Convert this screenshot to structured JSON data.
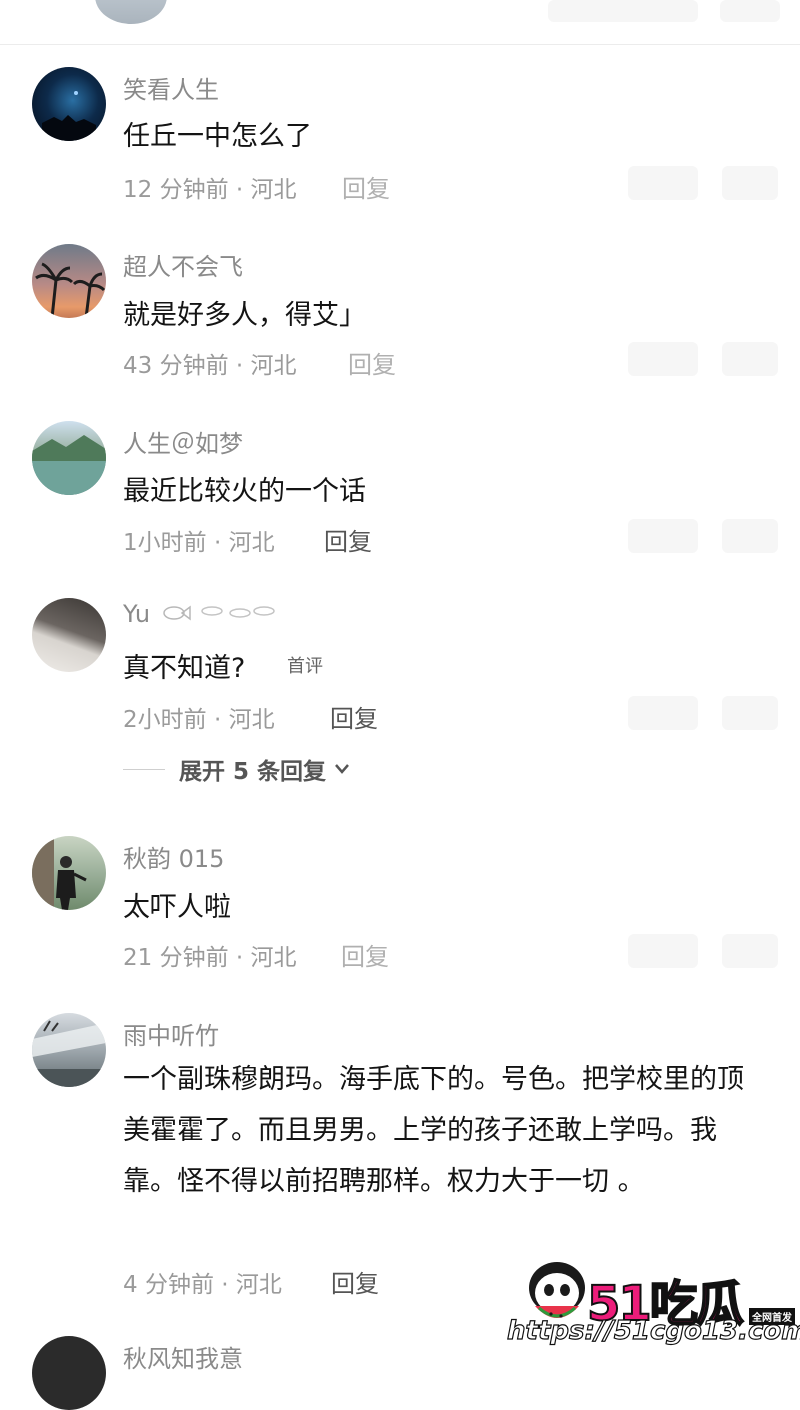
{
  "comments": [
    {
      "username": "笑看人生",
      "content": "任丘一中怎么了",
      "meta": "12 分钟前 · 河北",
      "reply": "回复"
    },
    {
      "username": "超人不会飞",
      "content": "就是好多人，得艾」",
      "meta": "43 分钟前 · 河北",
      "reply": "回复"
    },
    {
      "username": "人生＠如梦",
      "content": "最近比较火的一个话",
      "meta": "1小时前 · 河北",
      "reply": "回复"
    },
    {
      "username": "Yu",
      "content": "真不知道?",
      "badge": "首评",
      "meta": "2小时前 · 河北",
      "reply": "回复"
    },
    {
      "username": "秋韵 015",
      "content": "太吓人啦",
      "meta": "21 分钟前 · 河北",
      "reply": "回复"
    },
    {
      "username": "雨中听竹",
      "content": "一个副珠穆朗玛。海手底下的。号色。把学校里的顶美霍霍了。而且男男。上学的孩子还敢上学吗。我靠。怪不得以前招聘那样。权力大于一切 。",
      "meta": "4 分钟前 · 河北",
      "reply": "回复"
    },
    {
      "username": "秋风知我意"
    }
  ],
  "expand": {
    "label": "展开 5 条回复"
  },
  "watermark": {
    "brand": "51吃瓜",
    "tag": "全网首发",
    "url": "https://51cgo13.com"
  },
  "colors": {
    "username": "#8a8a8a",
    "meta": "#9a9a9a",
    "text": "#141414",
    "watermark_pink": "#ec1d7a"
  }
}
